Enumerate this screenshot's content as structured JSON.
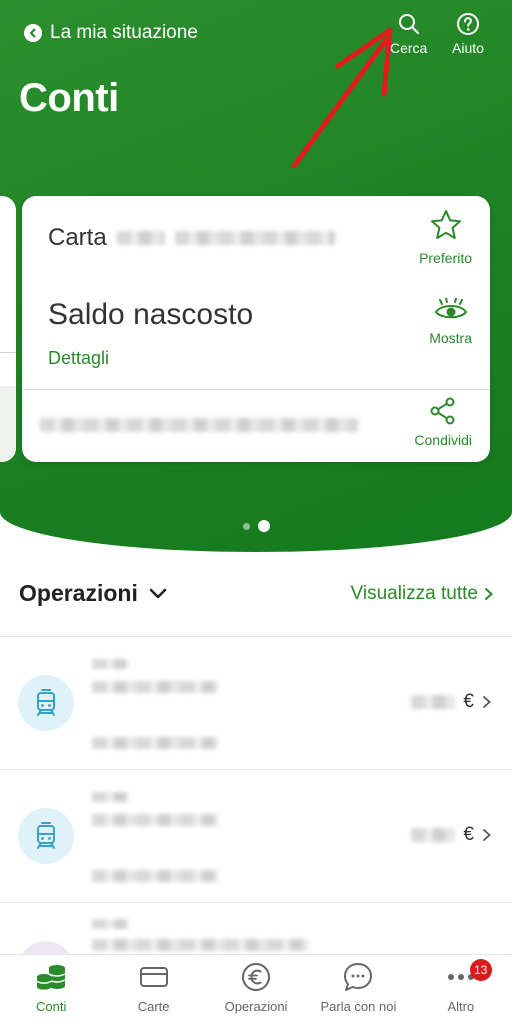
{
  "header": {
    "back_label": "La mia situazione",
    "search_label": "Cerca",
    "help_label": "Aiuto",
    "title": "Conti"
  },
  "account_card": {
    "card_label": "Carta",
    "balance_label": "Saldo nascosto",
    "details_label": "Dettagli",
    "favorite_label": "Preferito",
    "show_label": "Mostra",
    "share_label": "Condividi"
  },
  "carousel": {
    "total": 2,
    "active_index": 2
  },
  "operations": {
    "title": "Operazioni",
    "view_all_label": "Visualizza tutte",
    "currency": "€",
    "rows": [
      {
        "icon": "tram-icon"
      },
      {
        "icon": "tram-icon"
      },
      {
        "icon": "generic-icon"
      }
    ]
  },
  "tabbar": {
    "items": [
      {
        "label": "Conti",
        "icon": "coins-icon",
        "active": true
      },
      {
        "label": "Carte",
        "icon": "card-icon",
        "active": false
      },
      {
        "label": "Operazioni",
        "icon": "euro-icon",
        "active": false
      },
      {
        "label": "Parla con noi",
        "icon": "chat-icon",
        "active": false
      },
      {
        "label": "Altro",
        "icon": "more-icon",
        "active": false,
        "badge": "13"
      }
    ]
  },
  "colors": {
    "brand_green": "#208325",
    "link_green": "#2a8a2a",
    "annotation_red": "#e21b1b",
    "badge_red": "#d81b1b"
  }
}
